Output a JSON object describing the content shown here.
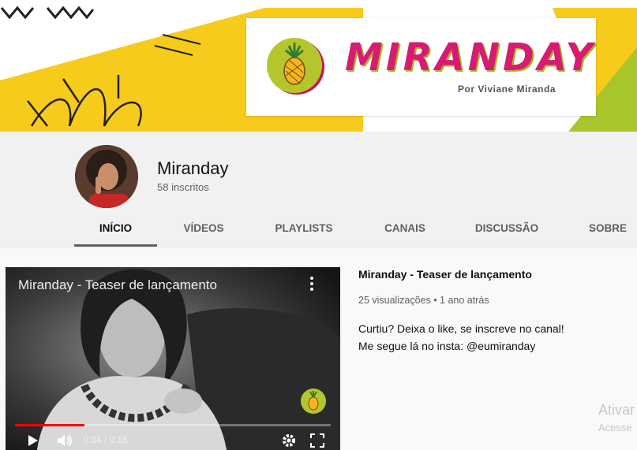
{
  "banner": {
    "logo_title": "MIRANDAY",
    "logo_subtitle": "Por Viviane Miranda",
    "colors": {
      "yellow": "#f7cb1b",
      "green": "#a8c62c",
      "magenta": "#d81b72"
    }
  },
  "channel": {
    "name": "Miranday",
    "subscribers": "58 inscritos"
  },
  "tabs": [
    {
      "label": "INÍCIO",
      "active": true
    },
    {
      "label": "VÍDEOS"
    },
    {
      "label": "PLAYLISTS"
    },
    {
      "label": "CANAIS"
    },
    {
      "label": "DISCUSSÃO"
    },
    {
      "label": "SOBRE"
    }
  ],
  "player": {
    "title": "Miranday - Teaser de lançamento",
    "time": "0:04 / 0:18",
    "progress": 0.22,
    "icons": [
      "play-icon",
      "volume-icon",
      "settings-gear-icon",
      "fullscreen-icon",
      "more-vert-icon"
    ]
  },
  "video": {
    "title": "Miranday - Teaser de lançamento",
    "meta": "25 visualizações • 1 ano atrás",
    "desc_line1": "Curtiu? Deixa o like, se inscreve no canal!",
    "desc_line2": "Me segue lá no insta: @eumiranday"
  },
  "watermark": {
    "line1": "Ativar",
    "line2": "Acesse"
  }
}
